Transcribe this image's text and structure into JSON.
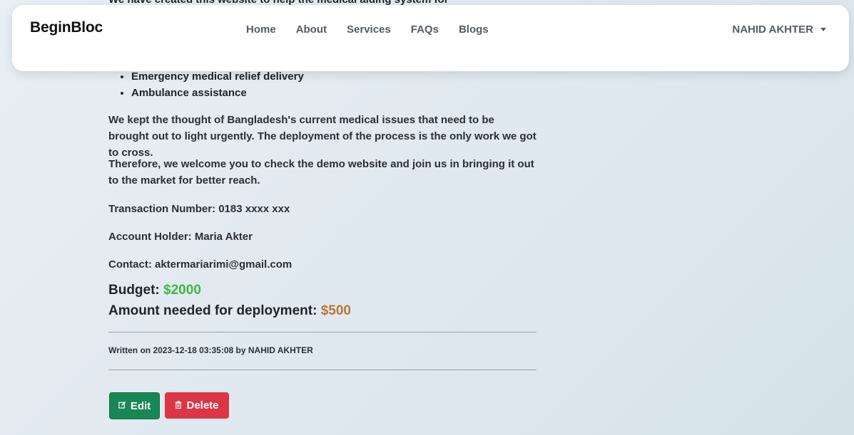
{
  "intro": {
    "partial_line": "We have created this website to help the medical aiding system for"
  },
  "navbar": {
    "brand": "BeginBloc",
    "links": [
      "Home",
      "About",
      "Services",
      "FAQs",
      "Blogs"
    ],
    "user": "NAHID AKHTER"
  },
  "features": [
    "Emergency medical relief delivery",
    "Ambulance assistance"
  ],
  "paragraphs": {
    "p1": "We kept the thought of Bangladesh's current medical issues that need to be brought out to light urgently. The deployment of the process is the only work we got to cross.",
    "p2": "Therefore, we welcome you to check the demo website and join us in bringing it out to the market for better reach.",
    "transaction": "Transaction Number: 0183 xxxx xxx",
    "holder": "Account Holder: Maria Akter",
    "contact": "Contact: aktermariarimi@gmail.com"
  },
  "funding": {
    "budget_label": "Budget:",
    "budget_value": "$2000",
    "needed_label": "Amount needed for deployment:",
    "needed_value": "$500",
    "budget_color": "#41b54a",
    "needed_color": "#b87837"
  },
  "meta": {
    "written": "Written on 2023-12-18 03:35:08 by NAHID AKHTER"
  },
  "actions": {
    "edit_label": "Edit",
    "edit_icon": "edit-icon",
    "delete_label": "Delete",
    "delete_icon": "trash-icon",
    "edit_color": "#198754",
    "delete_color": "#dc3545"
  }
}
